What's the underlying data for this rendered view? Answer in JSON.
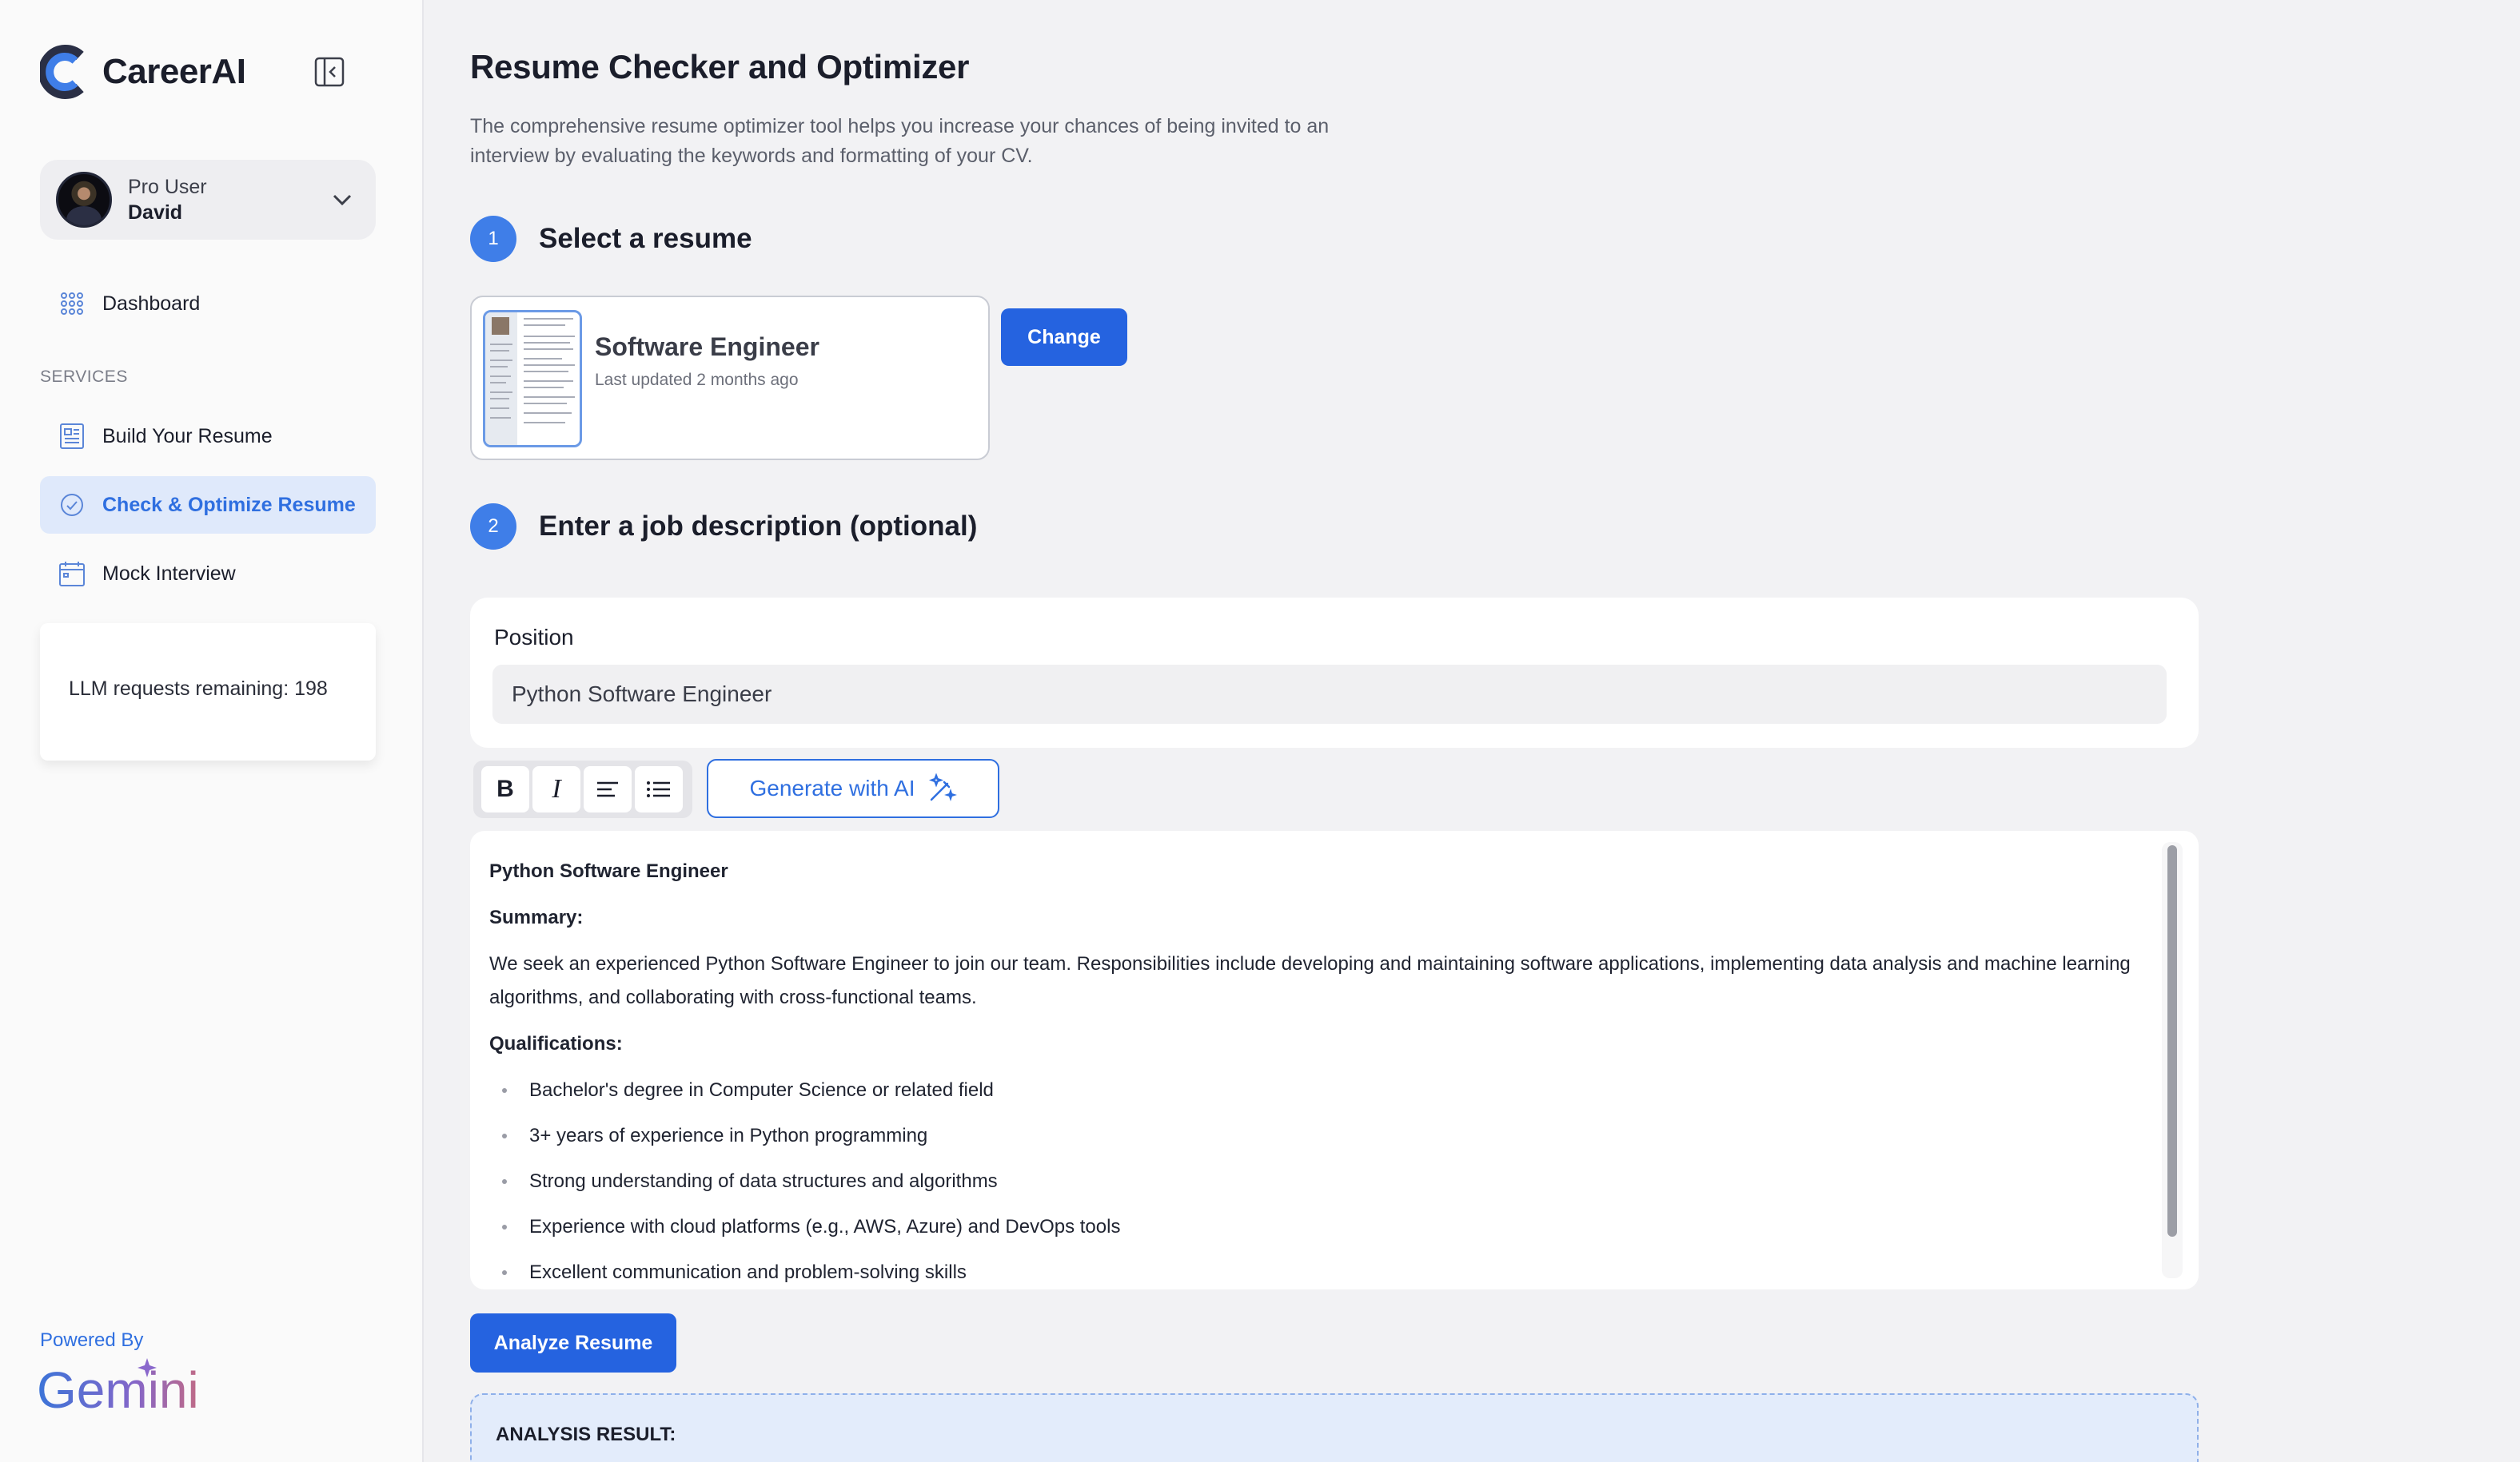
{
  "brand": {
    "name": "CareerAI"
  },
  "user": {
    "role": "Pro User",
    "name": "David"
  },
  "nav": {
    "dashboard": "Dashboard",
    "section_label": "SERVICES",
    "build_resume": "Build Your Resume",
    "check_optimize": "Check & Optimize Resume",
    "mock_interview": "Mock Interview"
  },
  "quota": {
    "text": "LLM requests remaining: 198"
  },
  "footer": {
    "powered_by": "Powered By",
    "gemini": "Gemini"
  },
  "page": {
    "title": "Resume Checker and Optimizer",
    "description": "The comprehensive resume optimizer tool helps you increase your chances of being invited to an interview by evaluating the keywords and formatting of your CV."
  },
  "step1": {
    "number": "1",
    "title": "Select a resume"
  },
  "resume": {
    "name": "Software Engineer",
    "updated": "Last updated 2 months ago",
    "change_label": "Change"
  },
  "step2": {
    "number": "2",
    "title": "Enter a job description (optional)"
  },
  "position": {
    "label": "Position",
    "value": "Python Software Engineer"
  },
  "toolbar": {
    "bold": "B",
    "italic": "I",
    "generate_label": "Generate with AI"
  },
  "editor": {
    "title": "Python Software Engineer",
    "summary_heading": "Summary:",
    "summary_text": "We seek an experienced Python Software Engineer to join our team. Responsibilities include developing and maintaining software applications, implementing data analysis and machine learning algorithms, and collaborating with cross-functional teams.",
    "qualifications_heading": "Qualifications:",
    "qualifications": [
      "Bachelor's degree in Computer Science or related field",
      "3+ years of experience in Python programming",
      "Strong understanding of data structures and algorithms",
      "Experience with cloud platforms (e.g., AWS, Azure) and DevOps tools",
      "Excellent communication and problem-solving skills"
    ]
  },
  "actions": {
    "analyze_label": "Analyze Resume"
  },
  "analysis": {
    "label": "ANALYSIS RESULT:"
  },
  "colors": {
    "accent": "#2563e0",
    "active_bg": "#dfe9fb",
    "step_circle": "#3f7ee8"
  }
}
